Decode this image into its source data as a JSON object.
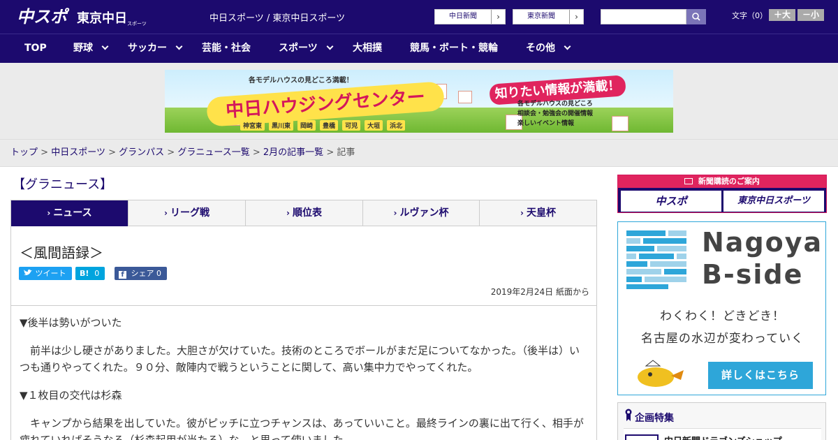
{
  "header": {
    "site_name": "中日スポーツ / 東京中日スポーツ",
    "btn_chunichi": "中日新聞",
    "btn_tokyo": "東京新聞",
    "search_placeholder": "",
    "font_label": "文字（0）",
    "font_larger": "＋大",
    "font_smaller": "－小",
    "arrow": "›"
  },
  "nav": {
    "items": [
      {
        "label": "TOP"
      },
      {
        "label": "野球"
      },
      {
        "label": "サッカー"
      },
      {
        "label": "芸能・社会"
      },
      {
        "label": "スポーツ"
      },
      {
        "label": "大相撲"
      },
      {
        "label": "競馬・ボート・競輪"
      },
      {
        "label": "その他"
      }
    ]
  },
  "banner": {
    "top_text": "各モデルハウスの見どころ満載！",
    "title": "中日ハウジングセンター",
    "pill": "知りたい情報が満載！",
    "list": [
      "各モデルハウスの見どころ",
      "相談会・勉強会の開催情報",
      "楽しいイベント情報"
    ],
    "tags": [
      "神宮東",
      "黒川東",
      "岡崎",
      "豊橋",
      "可児",
      "大垣",
      "浜北"
    ]
  },
  "breadcrumb": {
    "items": [
      "トップ",
      "中日スポーツ",
      "グランパス",
      "グラニュース一覧",
      "2月の記事一覧"
    ],
    "current": "記事",
    "sep": ">"
  },
  "section_title": "【グラニュース】",
  "tabs": [
    {
      "label": "ニュース"
    },
    {
      "label": "リーグ戦"
    },
    {
      "label": "順位表"
    },
    {
      "label": "ルヴァン杯"
    },
    {
      "label": "天皇杯"
    }
  ],
  "article": {
    "title": "＜風間語録＞",
    "share_tweet": "ツイート",
    "share_hatena": "0",
    "share_fb": "シェア 0",
    "date": "2019年2月24日 紙面から",
    "q1": "▼後半は勢いがついた",
    "a1": "　前半は少し硬さがありました。大胆さが欠けていた。技術のところでボールがまだ足についてなかった。（後半は）いつも通りやってくれた。９０分、敵陣内で戦うということに関して、高い集中力でやってくれた。",
    "q2": "▼１枚目の交代は杉森",
    "a2": "　キャンプから結果を出していた。彼がピッチに立つチャンスは、あっていいこと。最終ラインの裏に出て行く、相手が疲れていればそうなる（杉森起用が当たる）な、と思って使いました。"
  },
  "sidebar": {
    "subscribe_title": "新聞購読のご案内",
    "sub_btn1": "中スポ",
    "sub_btn2": "東京中日スポーツ",
    "bside_line1": "Nagoya",
    "bside_line2": "B-side",
    "bside_msg1": "わくわく！どきどき！",
    "bside_msg2": "名古屋の水辺が変わっていく",
    "bside_btn": "詳しくはこちら",
    "feature_title": "企画特集",
    "feature_item": "中日新聞ドラゴンズショップ"
  },
  "colors": {
    "brand": "#1c0a6e",
    "accent_pink": "#e0245e",
    "bside_blue": "#2ea6d9",
    "twitter": "#1da1f2",
    "hatena": "#00a4de",
    "facebook": "#3b5998"
  }
}
